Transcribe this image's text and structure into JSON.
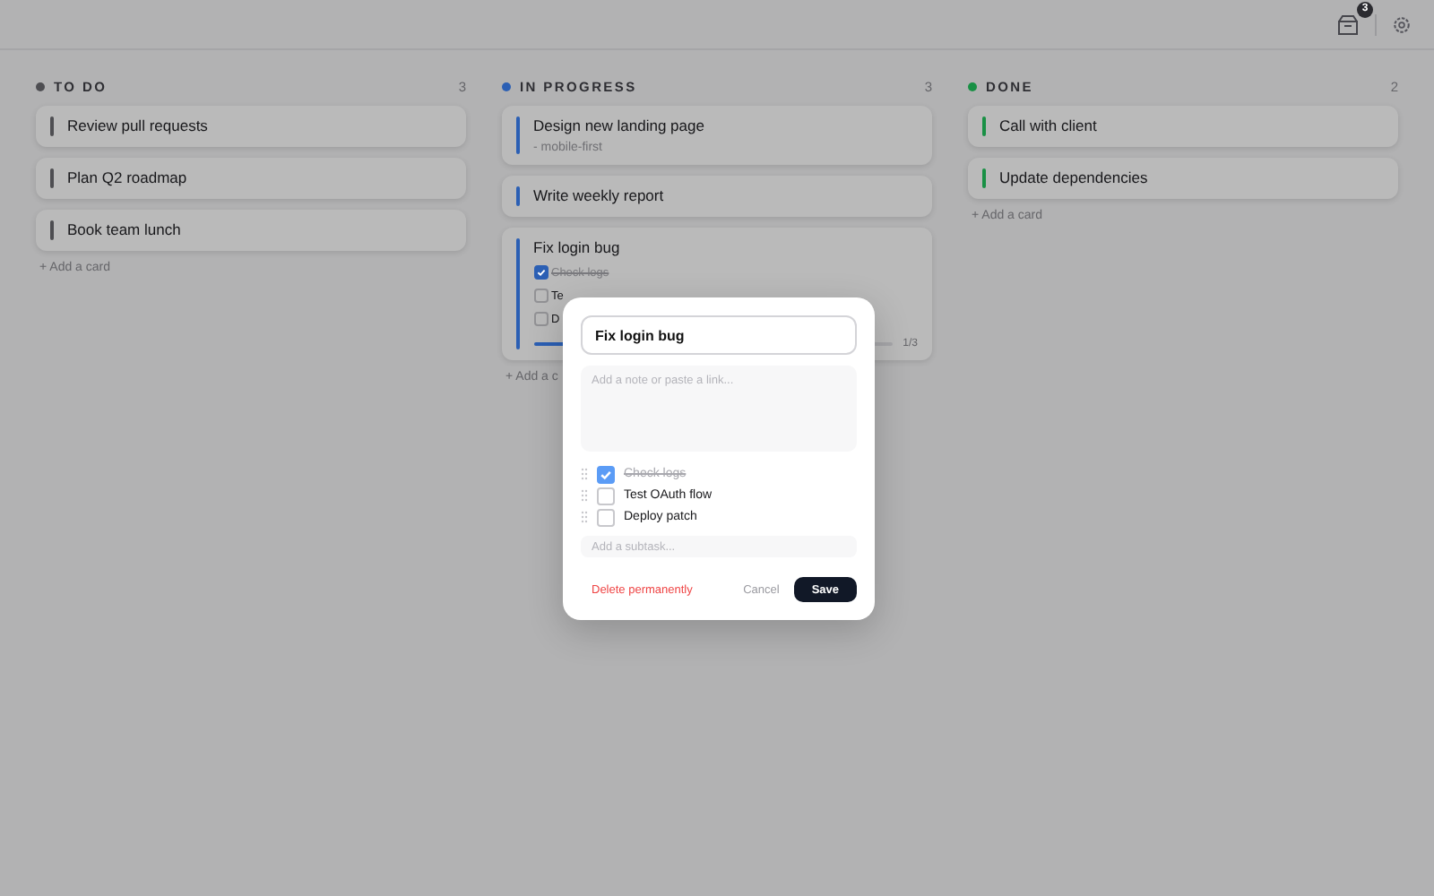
{
  "topbar": {
    "inbox_badge": "3"
  },
  "columns": [
    {
      "title": "TO DO",
      "color": "#4e4e52",
      "count": "3",
      "cards": [
        {
          "title": "Review pull requests"
        },
        {
          "title": "Plan Q2 roadmap"
        },
        {
          "title": "Book team lunch"
        }
      ],
      "add_label": "+ Add a card"
    },
    {
      "title": "IN PROGRESS",
      "color": "#2b5fb4",
      "count": "3",
      "cards": [
        {
          "title": "Design new landing page",
          "note": "- mobile-first"
        },
        {
          "title": "Write weekly report"
        },
        {
          "title": "Fix login bug",
          "subtasks": [
            {
              "text": "Check logs",
              "checked": true
            },
            {
              "text": "Te",
              "checked": false
            },
            {
              "text": "D",
              "checked": false
            }
          ],
          "progress": {
            "level": 0.33,
            "label": "1/3"
          }
        }
      ],
      "add_label": "+ Add a c"
    },
    {
      "title": "DONE",
      "color": "#199045",
      "count": "2",
      "cards": [
        {
          "title": "Call with client"
        },
        {
          "title": "Update dependencies"
        }
      ],
      "add_label": "+ Add a card"
    }
  ],
  "modal": {
    "title_value": "Fix login bug",
    "note_placeholder": "Add a note or paste a link...",
    "subtasks": [
      {
        "text": "Check logs",
        "checked": true
      },
      {
        "text": "Test OAuth flow",
        "checked": false
      },
      {
        "text": "Deploy patch",
        "checked": false
      }
    ],
    "subtask_placeholder": "Add a subtask...",
    "delete_label": "Delete permanently",
    "cancel_label": "Cancel",
    "save_label": "Save"
  }
}
